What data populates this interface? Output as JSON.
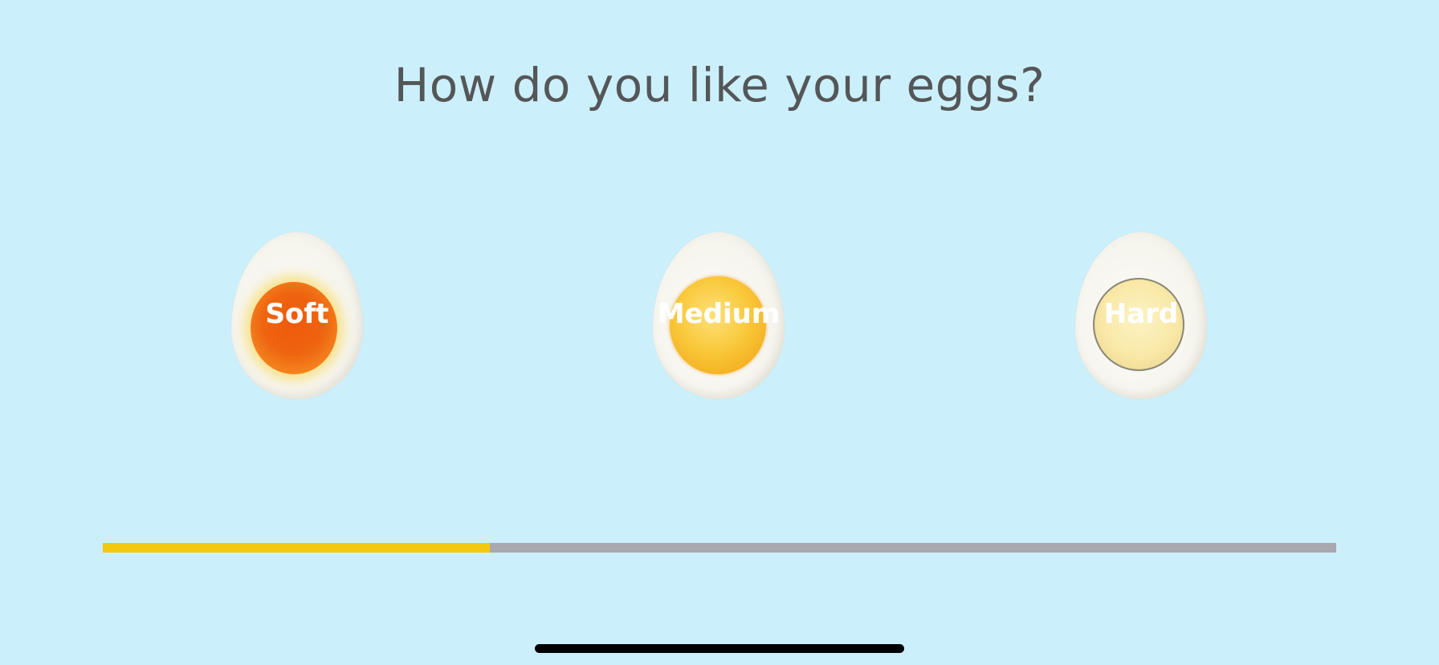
{
  "title": "How do you like your eggs?",
  "eggs": [
    {
      "id": "soft",
      "label": "Soft",
      "yolk_color": "#ef5d0c"
    },
    {
      "id": "medium",
      "label": "Medium",
      "yolk_color": "#f6be30"
    },
    {
      "id": "hard",
      "label": "Hard",
      "yolk_color": "#f9e9a8"
    }
  ],
  "progress": {
    "value": 0.314,
    "fill_color": "#f4c80f",
    "track_color": "#a8a8ae"
  },
  "colors": {
    "background": "#ccf0fb",
    "title_text": "#545658"
  }
}
